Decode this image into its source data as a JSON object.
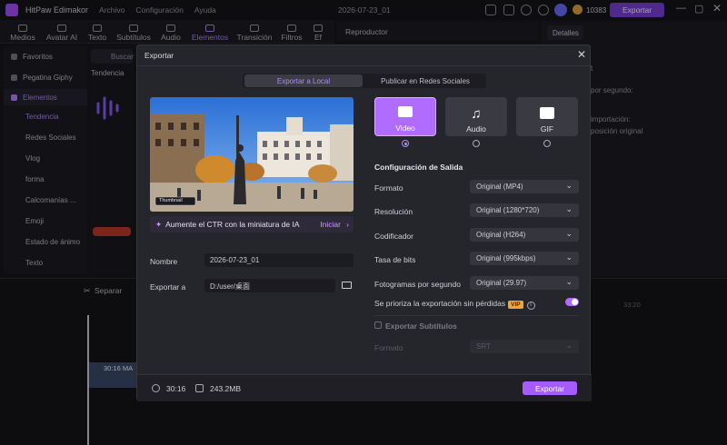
{
  "app": {
    "name": "HitPaw Edimakor",
    "menu": [
      "Archivo",
      "Configuración",
      "Ayuda"
    ],
    "doc_title": "2026-07-23_01",
    "credits": "10383",
    "export_top": "Exportar"
  },
  "tabs": [
    {
      "label": "Medios"
    },
    {
      "label": "Avatar AI"
    },
    {
      "label": "Texto"
    },
    {
      "label": "Subtítulos"
    },
    {
      "label": "Audio"
    },
    {
      "label": "Elementos"
    },
    {
      "label": "Transición"
    },
    {
      "label": "Filtros"
    },
    {
      "label": "Ef"
    }
  ],
  "sidebar": {
    "items": [
      {
        "label": "Favoritos"
      },
      {
        "label": "Pegatina Giphy"
      },
      {
        "label": "Elementos"
      }
    ],
    "subitems": [
      "Tendencia",
      "Redes Sociales",
      "Vlog",
      "forma",
      "Calcomanías ...",
      "Emoji",
      "Estado de ánimo",
      "Texto"
    ]
  },
  "assets": {
    "search": "Buscar",
    "section": "Tendencia"
  },
  "player": {
    "title": "Reproductor"
  },
  "details": {
    "tab": "Detalles",
    "lines": [
      "t",
      "por segundo:",
      "importación:",
      "posición original"
    ]
  },
  "timeline": {
    "split_label": "Separar",
    "clip_label": "30:16 MA",
    "time_mark": "33:20"
  },
  "modal": {
    "title": "Exportar",
    "seg_local": "Exportar a Local",
    "seg_social": "Publicar en Redes Sociales",
    "preview_caption": "Thumbnail",
    "cta_text": "Aumente el CTR con la miniatura de IA",
    "cta_action": "Iniciar",
    "name_label": "Nombre",
    "name_value": "2026-07-23_01",
    "export_to_label": "Exportar a",
    "export_to_value": "D:/user/桌面",
    "types": [
      {
        "label": "Video",
        "icon": "video-icon"
      },
      {
        "label": "Audio",
        "icon": "music-note-icon"
      },
      {
        "label": "GIF",
        "icon": "gif-icon"
      }
    ],
    "section_title": "Configuración de Salida",
    "settings": [
      {
        "label": "Formato",
        "value": "Original (MP4)"
      },
      {
        "label": "Resolución",
        "value": "Original (1280*720)"
      },
      {
        "label": "Codificador",
        "value": "Original (H264)"
      },
      {
        "label": "Tasa de bits",
        "value": "Original (995kbps)"
      },
      {
        "label": "Fotogramas por segundo",
        "value": "Original (29.97)"
      }
    ],
    "lossless_label": "Se prioriza la exportación sin pérdidas",
    "vip": "VIP",
    "subtitles_label": "Exportar Subtítulos",
    "subtitles_format_label": "Formato",
    "subtitles_format_value": "SRT",
    "duration": "30:16",
    "size": "243.2MB",
    "export_button": "Exportar"
  },
  "colors": {
    "accent": "#a45cff",
    "bg": "#17171c",
    "modal": "#25252c"
  }
}
